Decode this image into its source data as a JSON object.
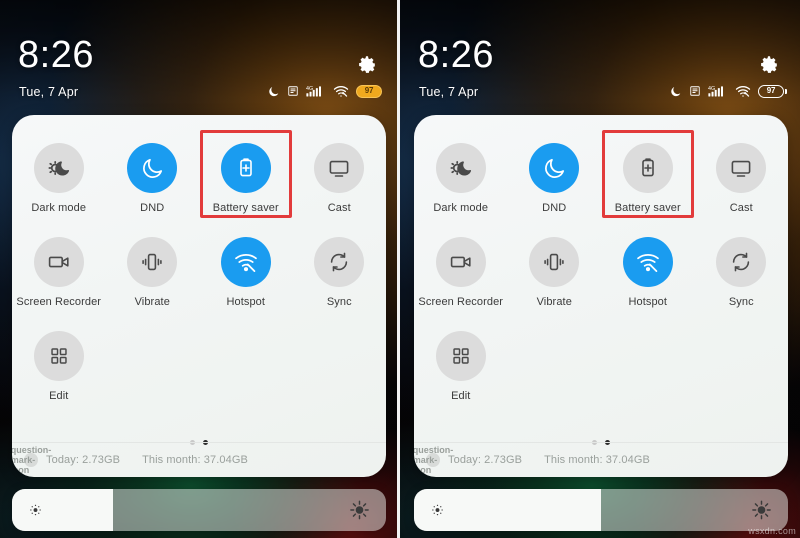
{
  "watermark": "wsxdn.com",
  "panels": [
    {
      "id": "left",
      "state_label": "battery-saver-on",
      "status": {
        "time": "8:26",
        "date": "Tue, 7 Apr",
        "battery_percent": "97",
        "battery_mode": "saver",
        "network_type": "4G",
        "icons": [
          "dnd-moon-icon",
          "alarm-icon",
          "signal-4g-icon",
          "wifi-icon",
          "battery-icon"
        ],
        "settings_icon": "gear-icon"
      },
      "tiles": [
        {
          "label": "Dark mode",
          "icon": "dark-mode-icon",
          "active": false
        },
        {
          "label": "DND",
          "icon": "moon-icon",
          "active": true
        },
        {
          "label": "Battery saver",
          "icon": "battery-plus-icon",
          "active": true,
          "highlighted": true
        },
        {
          "label": "Cast",
          "icon": "cast-icon",
          "active": false
        },
        {
          "label": "Screen Recorder",
          "icon": "video-camera-icon",
          "active": false
        },
        {
          "label": "Vibrate",
          "icon": "vibrate-icon",
          "active": false
        },
        {
          "label": "Hotspot",
          "icon": "hotspot-icon",
          "active": true
        },
        {
          "label": "Sync",
          "icon": "sync-icon",
          "active": false
        },
        {
          "label": "Edit",
          "icon": "grid-edit-icon",
          "active": false
        }
      ],
      "pager": {
        "pages": 2,
        "active_index": 1
      },
      "footer": {
        "help_icon": "question-mark-icon",
        "today_usage": "Today: 2.73GB",
        "month_usage": "This month: 37.04GB"
      },
      "brightness": {
        "low_icon": "sun-low-icon",
        "high_icon": "sun-high-icon",
        "value_percent": "27"
      }
    },
    {
      "id": "right",
      "state_label": "battery-saver-off",
      "status": {
        "time": "8:26",
        "date": "Tue, 7 Apr",
        "battery_percent": "97",
        "battery_mode": "normal",
        "network_type": "4G",
        "icons": [
          "dnd-moon-icon",
          "alarm-icon",
          "signal-4g-icon",
          "wifi-icon",
          "battery-icon"
        ],
        "settings_icon": "gear-icon"
      },
      "tiles": [
        {
          "label": "Dark mode",
          "icon": "dark-mode-icon",
          "active": false
        },
        {
          "label": "DND",
          "icon": "moon-icon",
          "active": true
        },
        {
          "label": "Battery saver",
          "icon": "battery-plus-icon",
          "active": false,
          "highlighted": true
        },
        {
          "label": "Cast",
          "icon": "cast-icon",
          "active": false
        },
        {
          "label": "Screen Recorder",
          "icon": "video-camera-icon",
          "active": false
        },
        {
          "label": "Vibrate",
          "icon": "vibrate-icon",
          "active": false
        },
        {
          "label": "Hotspot",
          "icon": "hotspot-icon",
          "active": true
        },
        {
          "label": "Sync",
          "icon": "sync-icon",
          "active": false
        },
        {
          "label": "Edit",
          "icon": "grid-edit-icon",
          "active": false
        }
      ],
      "pager": {
        "pages": 2,
        "active_index": 1
      },
      "footer": {
        "help_icon": "question-mark-icon",
        "today_usage": "Today: 2.73GB",
        "month_usage": "This month: 37.04GB"
      },
      "brightness": {
        "low_icon": "sun-low-icon",
        "high_icon": "sun-high-icon",
        "value_percent": "50"
      }
    }
  ],
  "colors": {
    "accent_active": "#1a9cf0",
    "tile_inactive": "#dcdcdc",
    "highlight_red": "#e23b3b",
    "battery_saver_amber": "#f0a91e"
  }
}
